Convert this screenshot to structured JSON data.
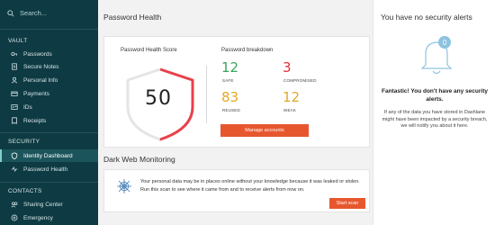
{
  "sidebar": {
    "search_label": "Search...",
    "sections": {
      "vault": "VAULT",
      "security": "SECURITY",
      "contacts": "CONTACTS"
    },
    "vault_items": [
      {
        "label": "Passwords",
        "icon": "key-icon"
      },
      {
        "label": "Secure Notes",
        "icon": "note-icon"
      },
      {
        "label": "Personal Info",
        "icon": "person-icon"
      },
      {
        "label": "Payments",
        "icon": "card-icon"
      },
      {
        "label": "IDs",
        "icon": "id-icon"
      },
      {
        "label": "Receipts",
        "icon": "receipt-icon"
      }
    ],
    "security_items": [
      {
        "label": "Identity Dashboard",
        "icon": "shield-icon",
        "active": true
      },
      {
        "label": "Password Health",
        "icon": "health-icon",
        "active": false
      }
    ],
    "contact_items": [
      {
        "label": "Sharing Center",
        "icon": "share-icon"
      },
      {
        "label": "Emergency",
        "icon": "emergency-icon"
      }
    ]
  },
  "main": {
    "title": "Password Health",
    "health_card": {
      "score_label": "Password Health Score",
      "score": "50",
      "score_fraction": 0.5,
      "breakdown_label": "Password breakdown",
      "stats": [
        {
          "value": "12",
          "label": "SAFE",
          "color": "#3aa65a"
        },
        {
          "value": "3",
          "label": "COMPROMISED",
          "color": "#e1303c"
        },
        {
          "value": "83",
          "label": "REUSED",
          "color": "#e2a92a"
        },
        {
          "value": "12",
          "label": "WEAK",
          "color": "#e2a92a"
        }
      ],
      "button_label": "Manage accounts"
    },
    "dark_web": {
      "title": "Dark Web Monitoring",
      "text": "Your personal data may be in places online without your knowledge because it was leaked or stolen. Run this scan to see where it came from and to receive alerts from now on.",
      "button_label": "Start scan"
    }
  },
  "right_panel": {
    "title": "You have no security alerts",
    "badge_count": "0",
    "headline": "Fantastic! You don't have any security alerts.",
    "note": "If any of the data you have stored in Dashlane might have been impacted by a security breach, we will notify you about it here."
  },
  "colors": {
    "sidebar_bg": "#0e3b43",
    "accent_button": "#e7572e",
    "gauge_red": "#e8414b",
    "bell_blue": "#8ec3df"
  }
}
